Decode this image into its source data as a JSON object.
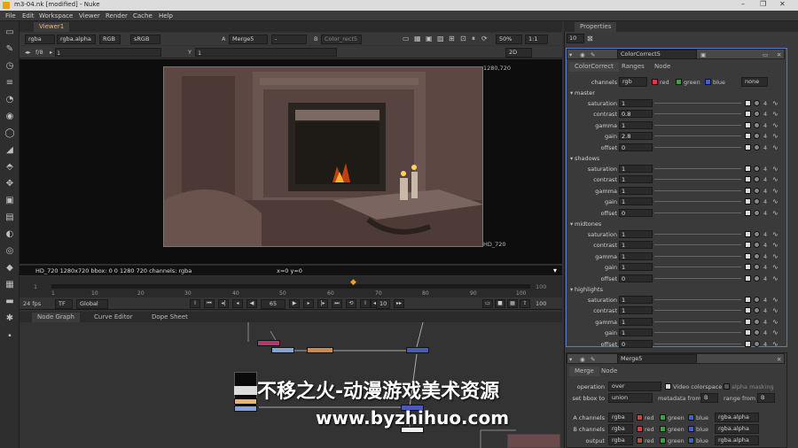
{
  "window": {
    "title": "m3-04.nk [modified] - Nuke",
    "controls": [
      "–",
      "❐",
      "✕"
    ]
  },
  "menu": [
    "File",
    "Edit",
    "Workspace",
    "Viewer",
    "Render",
    "Cache",
    "Help"
  ],
  "viewer": {
    "tab": "Viewer1",
    "channels": "rgba",
    "alpha": "rgba.alpha",
    "colorspace_a": "RGB",
    "lut": "sRGB",
    "input_a_label": "A",
    "input_a": "Merge5",
    "input_a_op": "-",
    "input_b_label": "B",
    "input_b": "Color_rect5",
    "zoom": "50%",
    "ratio": "1:1",
    "fstop": "f/8",
    "frame_field": "1",
    "y_label": "Y",
    "y_value": "1",
    "mode_2d": "2D",
    "format_top": "1280,720",
    "format_bottom": "HD_720",
    "status": "HD_720 1280x720  bbox: 0 0 1280 720 channels: rgba",
    "coords": "x=0 y=0"
  },
  "timeline": {
    "start": "1",
    "end": "100",
    "ticks": [
      "1",
      "10",
      "20",
      "30",
      "40",
      "50",
      "60",
      "70",
      "80",
      "90",
      "100"
    ],
    "current_frame": "65",
    "fps": "24 fps",
    "tf": "TF",
    "range": "Global",
    "step": "10",
    "end_field": "100"
  },
  "nodegraph": {
    "tabs": [
      "Node Graph",
      "Curve Editor",
      "Dope Sheet"
    ]
  },
  "properties": {
    "title": "Properties",
    "max_panels": "10",
    "cc": {
      "name": "ColorCorrect5",
      "tabs": [
        "ColorCorrect",
        "Ranges",
        "Node"
      ],
      "channels_label": "channels",
      "channels_value": "rgb",
      "red": "red",
      "green": "green",
      "blue": "blue",
      "none": "none",
      "sections": [
        {
          "name": "master",
          "rows": [
            {
              "label": "saturation",
              "value": "1"
            },
            {
              "label": "contrast",
              "value": "0.8"
            },
            {
              "label": "gamma",
              "value": "1"
            },
            {
              "label": "gain",
              "value": "2.8"
            },
            {
              "label": "offset",
              "value": "0"
            }
          ]
        },
        {
          "name": "shadows",
          "rows": [
            {
              "label": "saturation",
              "value": "1"
            },
            {
              "label": "contrast",
              "value": "1"
            },
            {
              "label": "gamma",
              "value": "1"
            },
            {
              "label": "gain",
              "value": "1"
            },
            {
              "label": "offset",
              "value": "0"
            }
          ]
        },
        {
          "name": "midtones",
          "rows": [
            {
              "label": "saturation",
              "value": "1"
            },
            {
              "label": "contrast",
              "value": "1"
            },
            {
              "label": "gamma",
              "value": "1"
            },
            {
              "label": "gain",
              "value": "1"
            },
            {
              "label": "offset",
              "value": "0"
            }
          ]
        },
        {
          "name": "highlights",
          "rows": [
            {
              "label": "saturation",
              "value": "1"
            },
            {
              "label": "contrast",
              "value": "1"
            },
            {
              "label": "gamma",
              "value": "1"
            },
            {
              "label": "gain",
              "value": "1"
            },
            {
              "label": "offset",
              "value": "0"
            }
          ]
        }
      ]
    },
    "merge": {
      "name": "Merge5",
      "tabs": [
        "Merge",
        "Node"
      ],
      "operation_label": "operation",
      "operation": "over",
      "video_colorspace": "Video colorspace",
      "alpha_masking": "alpha masking",
      "bbox_label": "set bbox to",
      "bbox": "union",
      "metadata_label": "metadata from",
      "metadata": "B",
      "range_label": "range from",
      "range": "B",
      "a_channels_label": "A channels",
      "a_channels": "rgba",
      "b_channels_label": "B channels",
      "b_channels": "rgba",
      "output_label": "output",
      "output": "rgba",
      "alpha_field": "rgba.alpha",
      "red": "red",
      "green": "green",
      "blue": "blue"
    }
  },
  "watermark": {
    "line1": "不移之火-动漫游戏美术资源",
    "line2": "www.byzhihuo.com"
  }
}
